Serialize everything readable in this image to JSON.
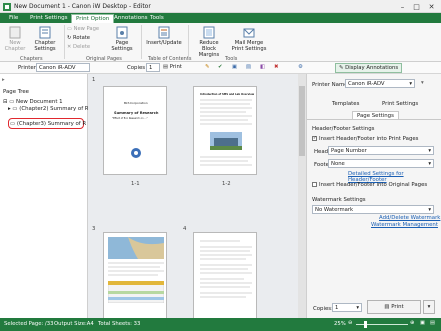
{
  "window": {
    "title": "New Document 1 - Canon iW Desktop - Editor"
  },
  "ribbon_tabs": [
    "File",
    "Print Settings",
    "Print Option",
    "Annotations",
    "Tools"
  ],
  "ribbon": {
    "new_chapter": "New Chapter",
    "chapter_settings": "Chapter Settings",
    "new_page": "New Page",
    "rotate": "Rotate",
    "delete": "Delete",
    "page_settings": "Page Settings",
    "insert_update": "Insert/Update",
    "reduce_block_margins": "Reduce Block Margins",
    "mail_merge": "Mail Merge Print Settings",
    "groups": [
      "Chapters",
      "Original Pages",
      "Table of Contents",
      "Tools"
    ]
  },
  "toolbar": {
    "printer_label": "Printer",
    "printer_value": "Canon iR-ADV",
    "copies_label": "Copies",
    "copies_value": "1",
    "print_label": "Print",
    "display_annotations": "Display Annotations"
  },
  "tree": {
    "title": "Page Tree",
    "root": "New Document 1",
    "items": [
      "(Chapter2) Summary of R",
      "(Chapter3) Summary of R"
    ]
  },
  "pages": {
    "row1": {
      "col_label": "1",
      "labels": [
        "1-1",
        "1-2"
      ]
    },
    "row2": {
      "col_label": "3",
      "col_label_b": "4"
    },
    "page1_title": "Summary of Research",
    "page1_sub": "\"Effect of Eco Research on ...\"",
    "page1_header": "BLT-Corporation",
    "page2_header": "Introduction of SMS and Lab Overview"
  },
  "panel": {
    "printer_label": "Printer Name:",
    "printer_value": "Canon iR-ADV",
    "tabs": [
      "Templates",
      "Print Settings"
    ],
    "active_tab": "Page Settings",
    "hf_section": "Header/Footer Settings",
    "insert_hf_print": "Insert Header/Footer into Print Pages",
    "header_label": "Header",
    "header_value": "Page Number",
    "footer_label": "Footer",
    "footer_value": "None",
    "detailed_link": "Detailed Settings for Header/Footer",
    "insert_hf_orig": "Insert Header/Footer into Original Pages",
    "wm_section": "Watermark Settings",
    "wm_value": "No Watermark",
    "add_delete_wm": "Add/Delete Watermark",
    "wm_mgmt": "Watermark Management",
    "copies_label": "Copies:",
    "copies_value": "1",
    "print_button": "Print"
  },
  "status": {
    "selected": "Selected Page: /33",
    "output_size": "Output Size:A4",
    "total": "Total Sheets: 33",
    "zoom": "25%"
  },
  "colors": {
    "accent": "#227a3e",
    "highlight_red": "#e0282e",
    "link": "#1a5fb4"
  }
}
